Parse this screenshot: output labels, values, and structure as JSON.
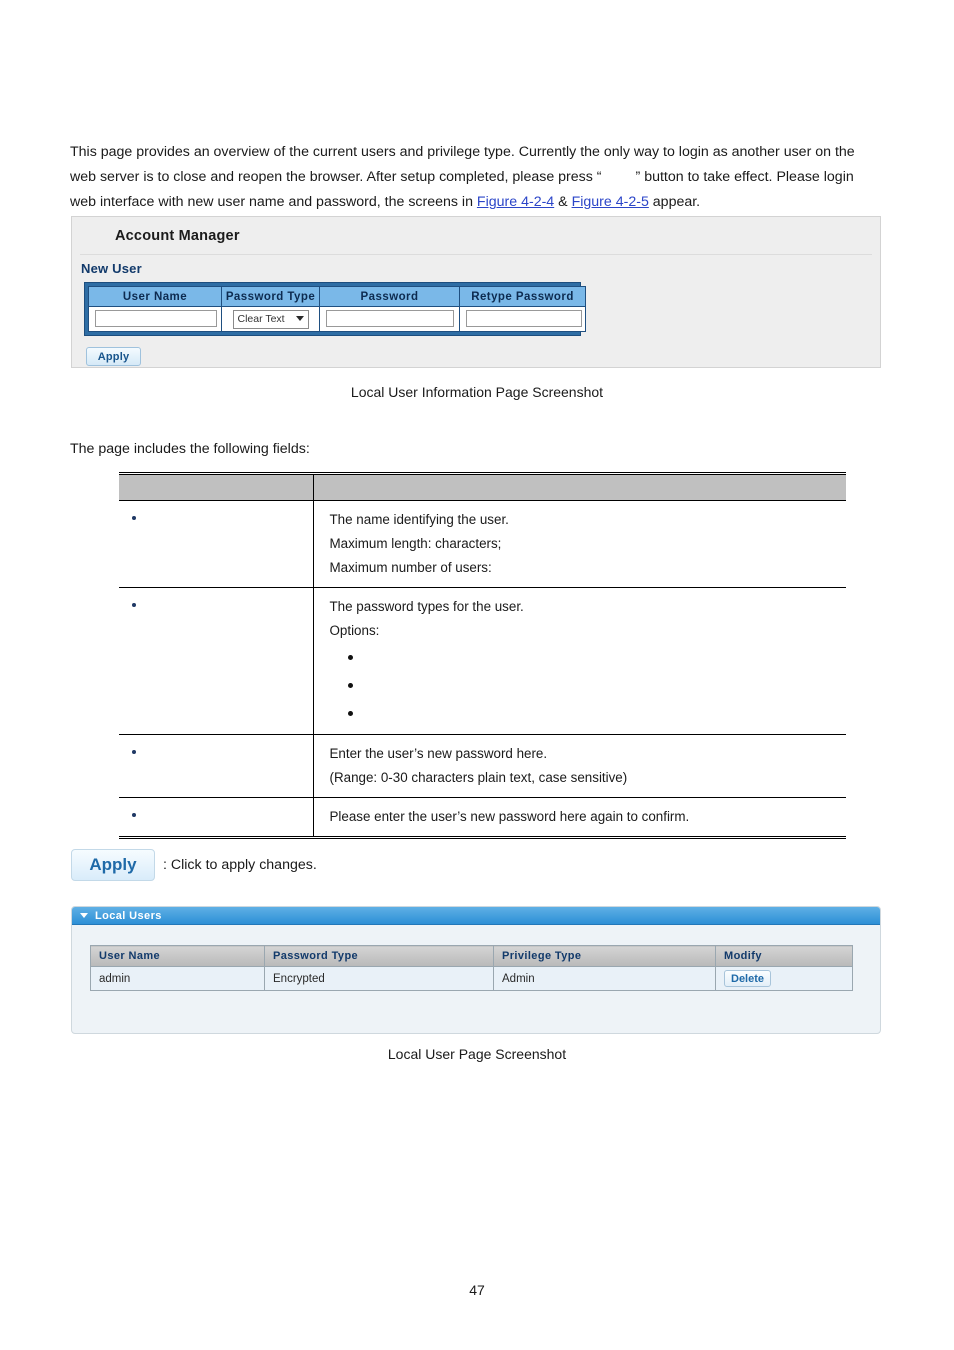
{
  "intro": {
    "part1": "This page provides an overview of the current users and privilege type. Currently the only way to login as another user on the web server is to close and reopen the browser. After setup completed, please press “",
    "part2": "” button to take effect. Please login web interface with new user name and password, the screens in ",
    "link1": "Figure 4-2-4",
    "amp": " & ",
    "link2": "Figure 4-2-5",
    "part3": " appear."
  },
  "account_manager": {
    "title": "Account Manager",
    "subtitle": "New User",
    "columns": [
      "User Name",
      "Password Type",
      "Password",
      "Retype Password"
    ],
    "user_name_value": "",
    "user_name_placeholder": "",
    "password_type_selected": "Clear Text",
    "password_value": "",
    "retype_password_value": "",
    "apply_label": "Apply"
  },
  "caption_1": "Local User Information Page Screenshot",
  "lead_text": "The page includes the following fields:",
  "fields_table": {
    "header": [
      "",
      ""
    ],
    "rows": [
      {
        "name": "",
        "lines": [
          "The name identifying the user.",
          "Maximum length:      characters;",
          "Maximum number of users:"
        ],
        "options": []
      },
      {
        "name": "",
        "lines": [
          "The password types for the user.",
          "Options:"
        ],
        "options": [
          "",
          "",
          ""
        ]
      },
      {
        "name": "",
        "lines": [
          "Enter the user’s new password here.",
          "(Range: 0-30 characters plain text, case sensitive)"
        ],
        "options": []
      },
      {
        "name": "",
        "lines": [
          "Please enter the user’s new password here again to confirm."
        ],
        "options": []
      }
    ]
  },
  "apply_legend": {
    "button_label": "Apply",
    "text": ": Click to apply changes."
  },
  "local_users": {
    "panel_title": "Local Users",
    "columns": [
      "User Name",
      "Password Type",
      "Privilege Type",
      "Modify"
    ],
    "rows": [
      {
        "user_name": "admin",
        "password_type": "Encrypted",
        "privilege_type": "Admin",
        "modify_label": "Delete"
      }
    ]
  },
  "caption_2": "Local User Page Screenshot",
  "page_number": "47",
  "colors": {
    "link": "#2b45c8",
    "panel_bg": "#eeeeee",
    "table_header_blue": "#7ab8e8",
    "table_border_blue": "#2e6da4",
    "local_users_header": "#2d8fd6",
    "header_gray": "#c0c0c0"
  }
}
